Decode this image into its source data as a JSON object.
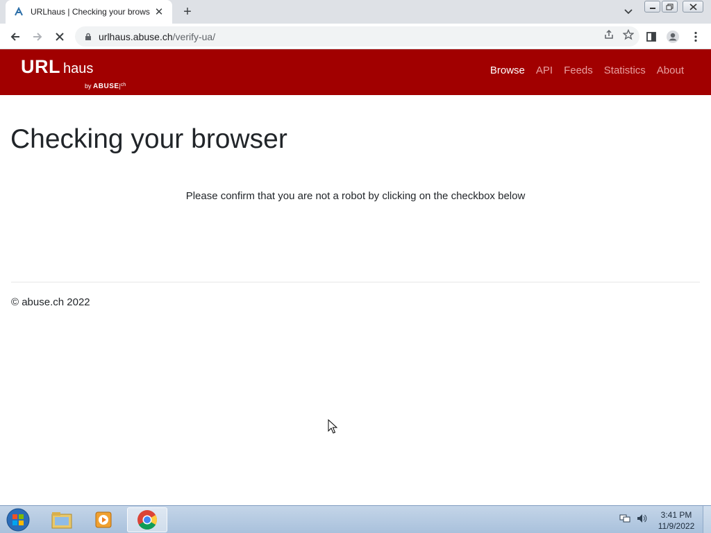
{
  "browser": {
    "tab_title": "URLhaus | Checking your browse",
    "url_host": "urlhaus.abuse.ch",
    "url_path": "/verify-ua/"
  },
  "site": {
    "logo_main": "URL",
    "logo_sub": "haus",
    "logo_by": "by",
    "logo_brand": "ABUSE",
    "logo_ch": "ch",
    "brand_color": "#a10000",
    "nav": [
      {
        "label": "Browse",
        "active": true
      },
      {
        "label": "API"
      },
      {
        "label": "Feeds"
      },
      {
        "label": "Statistics"
      },
      {
        "label": "About"
      }
    ]
  },
  "page": {
    "title": "Checking your browser",
    "confirm_text": "Please confirm that you are not a robot by clicking on the checkbox below",
    "copyright": "© abuse.ch 2022"
  },
  "taskbar": {
    "time": "3:41 PM",
    "date": "11/9/2022"
  }
}
